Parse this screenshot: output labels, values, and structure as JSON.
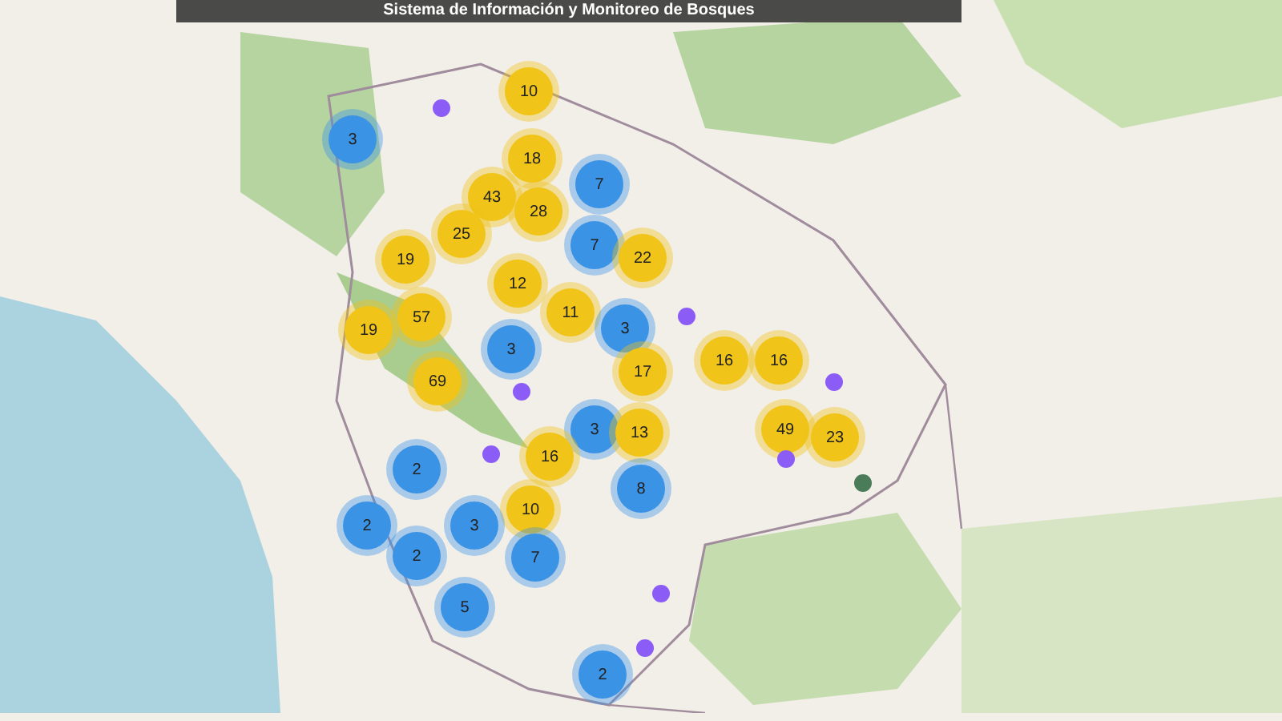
{
  "header": {
    "title": "Sistema de Información y Monitoreo de Bosques"
  },
  "markers": [
    {
      "kind": "cluster",
      "count": "10",
      "color": "#f0c419"
    },
    {
      "kind": "cluster",
      "count": "3",
      "color": "#3b93e6"
    },
    {
      "kind": "cluster",
      "count": "18",
      "color": "#f0c419"
    },
    {
      "kind": "cluster",
      "count": "7",
      "color": "#3b93e6"
    },
    {
      "kind": "cluster",
      "count": "43",
      "color": "#f0c419"
    },
    {
      "kind": "cluster",
      "count": "28",
      "color": "#f0c419"
    },
    {
      "kind": "cluster",
      "count": "25",
      "color": "#f0c419"
    },
    {
      "kind": "cluster",
      "count": "7",
      "color": "#3b93e6"
    },
    {
      "kind": "cluster",
      "count": "22",
      "color": "#f0c419"
    },
    {
      "kind": "cluster",
      "count": "19",
      "color": "#f0c419"
    },
    {
      "kind": "cluster",
      "count": "12",
      "color": "#f0c419"
    },
    {
      "kind": "cluster",
      "count": "11",
      "color": "#f0c419"
    },
    {
      "kind": "cluster",
      "count": "57",
      "color": "#f0c419"
    },
    {
      "kind": "cluster",
      "count": "19",
      "color": "#f0c419"
    },
    {
      "kind": "cluster",
      "count": "3",
      "color": "#3b93e6"
    },
    {
      "kind": "cluster",
      "count": "3",
      "color": "#3b93e6"
    },
    {
      "kind": "cluster",
      "count": "17",
      "color": "#f0c419"
    },
    {
      "kind": "cluster",
      "count": "16",
      "color": "#f0c419"
    },
    {
      "kind": "cluster",
      "count": "16",
      "color": "#f0c419"
    },
    {
      "kind": "cluster",
      "count": "69",
      "color": "#f0c419"
    },
    {
      "kind": "cluster",
      "count": "3",
      "color": "#3b93e6"
    },
    {
      "kind": "cluster",
      "count": "13",
      "color": "#f0c419"
    },
    {
      "kind": "cluster",
      "count": "49",
      "color": "#f0c419"
    },
    {
      "kind": "cluster",
      "count": "23",
      "color": "#f0c419"
    },
    {
      "kind": "cluster",
      "count": "16",
      "color": "#f0c419"
    },
    {
      "kind": "cluster",
      "count": "2",
      "color": "#3b93e6"
    },
    {
      "kind": "cluster",
      "count": "8",
      "color": "#3b93e6"
    },
    {
      "kind": "cluster",
      "count": "10",
      "color": "#f0c419"
    },
    {
      "kind": "cluster",
      "count": "2",
      "color": "#3b93e6"
    },
    {
      "kind": "cluster",
      "count": "3",
      "color": "#3b93e6"
    },
    {
      "kind": "cluster",
      "count": "2",
      "color": "#3b93e6"
    },
    {
      "kind": "cluster",
      "count": "7",
      "color": "#3b93e6"
    },
    {
      "kind": "cluster",
      "count": "5",
      "color": "#3b93e6"
    },
    {
      "kind": "cluster",
      "count": "2",
      "color": "#3b93e6"
    },
    {
      "kind": "point",
      "color": "#8b5cf6"
    },
    {
      "kind": "point",
      "color": "#8b5cf6"
    },
    {
      "kind": "point",
      "color": "#8b5cf6"
    },
    {
      "kind": "point",
      "color": "#8b5cf6"
    },
    {
      "kind": "point",
      "color": "#8b5cf6"
    },
    {
      "kind": "point",
      "color": "#8b5cf6"
    },
    {
      "kind": "point",
      "color": "#8b5cf6"
    },
    {
      "kind": "point",
      "color": "#8b5cf6"
    },
    {
      "kind": "point",
      "color": "#4a7c59"
    }
  ]
}
